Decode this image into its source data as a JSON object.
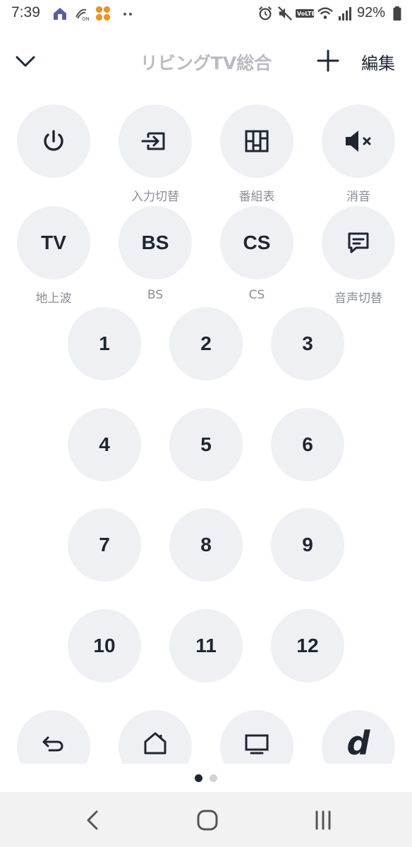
{
  "status_bar": {
    "time": "7:39",
    "battery": "92%",
    "icons_left": [
      "home-icon",
      "nfc-icon",
      "app-grid-icon",
      "more-dots-icon"
    ],
    "icons_right": [
      "alarm-icon",
      "mute-icon",
      "volte-icon",
      "wifi-icon",
      "signal-icon",
      "battery-icon"
    ]
  },
  "header": {
    "title": "リビングTV総合",
    "edit_label": "編集"
  },
  "buttons": {
    "power": {
      "icon": "power-icon",
      "label": ""
    },
    "input": {
      "icon": "input-switch-icon",
      "label": "入力切替"
    },
    "guide": {
      "icon": "program-guide-icon",
      "label": "番組表"
    },
    "mute": {
      "icon": "mute-icon",
      "label": "消音"
    },
    "tv": {
      "text": "TV",
      "label": "地上波"
    },
    "bs": {
      "text": "BS",
      "label": "BS"
    },
    "cs": {
      "text": "CS",
      "label": "CS"
    },
    "audio": {
      "icon": "speech-bubble-icon",
      "label": "音声切替"
    }
  },
  "number_keys": [
    "1",
    "2",
    "3",
    "4",
    "5",
    "6",
    "7",
    "8",
    "9",
    "10",
    "11",
    "12"
  ],
  "bottom_row": {
    "back_icon": "return-icon",
    "home_icon": "home-icon",
    "tv_icon": "tv-screen-icon",
    "d_text": "d"
  },
  "pager": {
    "pages": 2,
    "active": 0
  },
  "colors": {
    "button_bg": "#eef0f3",
    "icon": "#1f2633",
    "label": "#8a8e95",
    "title": "#b9bcc2",
    "dot_active": "#1f2633",
    "dot_inactive": "#d0d3d8",
    "navbar_bg": "#f2f2f2"
  }
}
